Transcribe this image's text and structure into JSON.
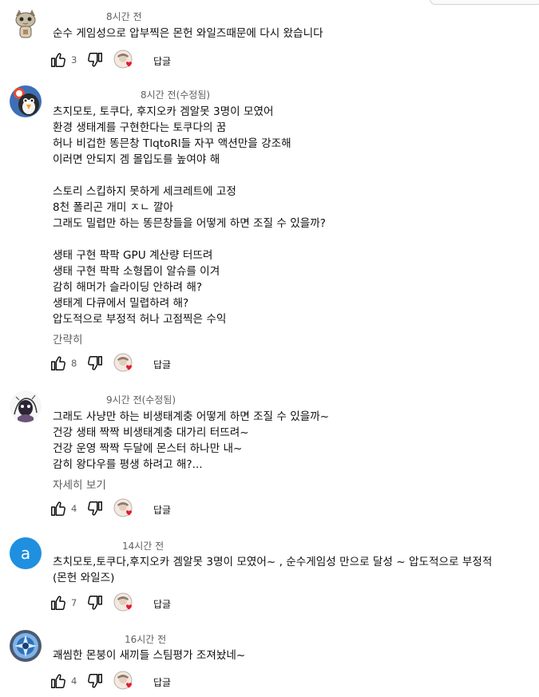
{
  "colors": {
    "text": "#0f0f0f",
    "secondary": "#606060",
    "heart": "#e8192c"
  },
  "comments": [
    {
      "avatar": "cat-avatar-icon",
      "timestamp": "8시간 전",
      "lines": [
        "순수 게임성으로 압부찍은 몬헌 와일즈때문에 다시 왔습니다"
      ],
      "likes": "3",
      "reply_label": "답글"
    },
    {
      "avatar": "cartoon-avatar-icon",
      "timestamp": "8시간 전(수정됨)",
      "lines": [
        "츠지모토, 토쿠다, 후지오카 겜알못 3명이 모였어",
        "환경 생태계를 구현한다는 토쿠다의 꿈",
        "허나 비겁한 똥믄창 TlqtoRl들 자꾸 액션만을 강조해",
        "이러면 안되지 겜 몰입도를 높여야 해",
        "",
        "스토리 스킵하지 못하게 세크레트에 고정",
        "8천 폴리곤 개미 ㅈㄴ 깔아",
        "그래도 밀렵만 하는 똥믄창들을 어떻게 하면 조질 수 있을까?",
        "",
        "생태 구현 팍팍 GPU 계산량 터뜨려",
        "생태 구현 팍팍 소형몹이 알슈를 이겨",
        "감히 해머가 슬라이딩 안하려 해?",
        "생태계 다큐에서 밀렵하려 해?",
        "압도적으로 부정적 허나 고점찍은 수익"
      ],
      "expand_label": "간략히",
      "likes": "8",
      "reply_label": "답글"
    },
    {
      "avatar": "sketch-avatar-icon",
      "timestamp": "9시간 전(수정됨)",
      "lines": [
        "그래도 사냥만 하는 비생태계충 어떻게 하면 조질 수 있을까~",
        "건강 생태 짝짝 비생태계충 대가리 터뜨려~",
        "건강 운영 짝짝 두달에 몬스터 하나만 내~",
        "감히 왕다우를 평생 하려고 해?..."
      ],
      "expand_label": "자세히 보기",
      "likes": "4",
      "reply_label": "답글"
    },
    {
      "avatar": "letter-a-avatar",
      "avatar_letter": "a",
      "timestamp": "14시간 전",
      "lines": [
        "츠치모토,토쿠다,후지오카 겜알못 3명이 모였어~ , 순수게임성 만으로 달성 ~ 압도적으로 부정적",
        "(몬헌 와일즈)"
      ],
      "likes": "7",
      "reply_label": "답글"
    },
    {
      "avatar": "blue-emblem-avatar-icon",
      "timestamp": "16시간 전",
      "lines": [
        "괘씸한 몬붕이 새끼들 스팀평가 조져놨네~"
      ],
      "likes": "4",
      "reply_label": "답글"
    }
  ]
}
